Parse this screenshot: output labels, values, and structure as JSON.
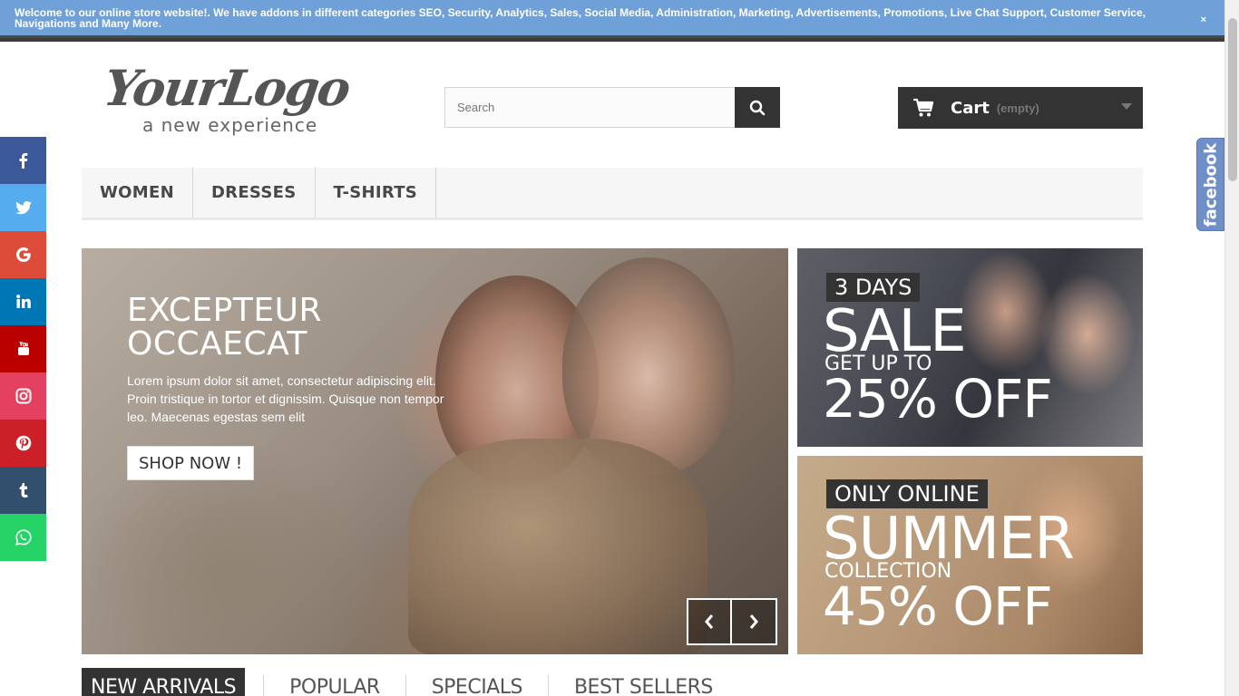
{
  "notice": {
    "text": "Welcome to our online store website!. We have addons in different categories SEO, Security, Analytics, Sales, Social Media, Administration, Marketing, Advertisements, Promotions, Live Chat Support, Customer Service, Navigations and Many More.",
    "close": "×"
  },
  "logo": {
    "main": "YourLogo",
    "sub": "a new experience"
  },
  "search": {
    "placeholder": "Search",
    "icon": "search-icon"
  },
  "cart": {
    "label": "Cart",
    "status": "(empty)",
    "icon": "cart-icon"
  },
  "menu": {
    "items": [
      "WOMEN",
      "DRESSES",
      "T-SHIRTS"
    ]
  },
  "social": {
    "items": [
      {
        "name": "facebook",
        "color": "#3b5998"
      },
      {
        "name": "twitter",
        "color": "#55acee"
      },
      {
        "name": "google",
        "color": "#dd4b39"
      },
      {
        "name": "linkedin",
        "color": "#0077b5"
      },
      {
        "name": "youtube",
        "color": "#bb0000"
      },
      {
        "name": "instagram",
        "color": "#e4405f"
      },
      {
        "name": "pinterest",
        "color": "#cb2027"
      },
      {
        "name": "tumblr",
        "color": "#32506d"
      },
      {
        "name": "whatsapp",
        "color": "#25d366"
      }
    ]
  },
  "facebook_tab": {
    "label": "facebook"
  },
  "hero": {
    "title_line1": "EXCEPTEUR",
    "title_line2": "OCCAECAT",
    "text": "Lorem ipsum dolor sit amet, consectetur adipiscing elit. Proin tristique in tortor et dignissim. Quisque non tempor leo. Maecenas egestas sem elit",
    "button": "SHOP NOW !"
  },
  "banner1": {
    "tag": "3 DAYS",
    "big": "SALE",
    "mid": "GET UP TO",
    "pct": "25% OFF"
  },
  "banner2": {
    "tag": "ONLY ONLINE",
    "big": "SUMMER",
    "mid": "COLLECTION",
    "pct": "45% OFF"
  },
  "tabs": {
    "items": [
      "NEW ARRIVALS",
      "POPULAR",
      "SPECIALS",
      "BEST SELLERS"
    ]
  }
}
